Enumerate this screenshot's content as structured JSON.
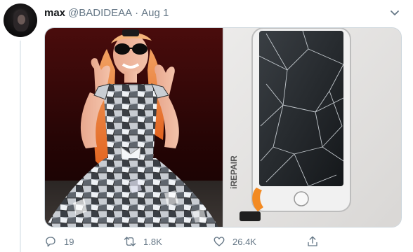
{
  "tweet": {
    "display_name": "max",
    "handle": "@BADIDEAA",
    "separator": "·",
    "date": "Aug 1"
  },
  "media": {
    "left_image": "woman-in-shattered-mirror-dress",
    "right_image": "cracked-phone-screen",
    "phone_sticker_text": "iREPAIR"
  },
  "actions": {
    "replies": "19",
    "retweets": "1.8K",
    "likes": "26.4K"
  },
  "colors": {
    "secondary_text": "#657786",
    "border": "#ccd6dd",
    "primary_text": "#14171a"
  },
  "icons": [
    "chevron-down-icon",
    "reply-icon",
    "retweet-icon",
    "like-icon",
    "share-icon"
  ]
}
